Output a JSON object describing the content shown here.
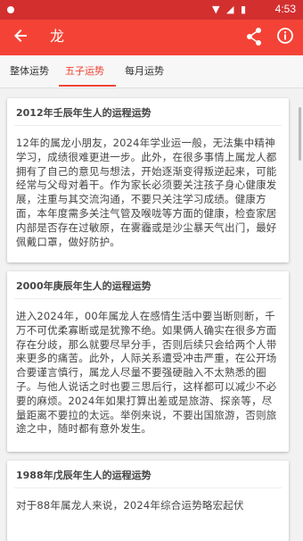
{
  "status_bar": {
    "time": "4:53",
    "icons_text": "▼ ◢ ▮"
  },
  "app_bar": {
    "back_icon": "arrow-back-icon",
    "title": "龙",
    "share_icon": "share-icon",
    "info_icon": "info-icon"
  },
  "tabs": [
    {
      "label": "整体运势"
    },
    {
      "label": "五子运势"
    },
    {
      "label": "每月运势"
    }
  ],
  "active_tab_index": 1,
  "colors": {
    "primary": "#f44336",
    "status_bar": "#d32f2f",
    "background": "#f2f2f2"
  },
  "cards": [
    {
      "title": "2012年壬辰年生人的运程运势",
      "body": "12年的属龙小朋友，2024年学业运一般，无法集中精神学习，成绩很难更进一步。此外，在很多事情上属龙人都拥有了自己的意见与想法，开始逐渐变得叛逆起来，可能经常与父母对着干。作为家长必须要关注孩子身心健康发展，注重与其交流沟通，不要只关注学习成绩。健康方面，本年度需多关注气管及喉咙等方面的健康，检查家居内部是否存在过敏原，在雾霾或是沙尘暴天气出门，最好佩戴口罩，做好防护。"
    },
    {
      "title": "2000年庚辰年生人的运程运势",
      "body": "进入2024年，00年属龙人在感情生活中要当断则断，千万不可优柔寡断或是犹豫不绝。如果俩人确实在很多方面存在分歧，那么就要尽早分手，否则后续只会给两个人带来更多的痛苦。此外，人际关系遭受冲击严重，在公开场合要谨言慎行，属龙人尽量不要强硬融入不太熟悉的圈子。与他人说话之时也要三思后行，这样都可以减少不必要的麻烦。2024年如果打算出差或是旅游、探亲等，尽量距离不要拉的太远。举例来说，不要出国旅游，否则旅途之中，随时都有意外发生。"
    },
    {
      "title": "1988年戊辰年生人的运程运势",
      "body": "对于88年属龙人来说，2024年综合运势略宏起伏"
    }
  ]
}
